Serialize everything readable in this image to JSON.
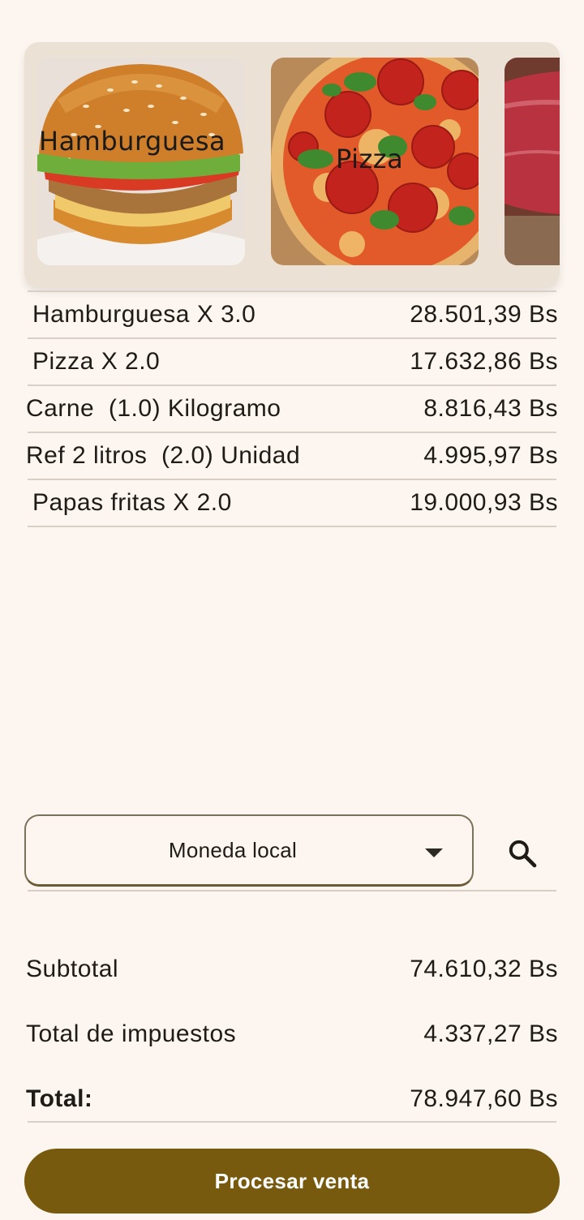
{
  "products": [
    {
      "label": "Hamburguesa",
      "icon": "burger-image"
    },
    {
      "label": "Pizza",
      "icon": "pizza-image"
    },
    {
      "label": "",
      "icon": "meat-image"
    }
  ],
  "items": [
    {
      "name": "Hamburguesa X 3.0",
      "price": "28.501,39 Bs"
    },
    {
      "name": "Pizza X 2.0",
      "price": "17.632,86 Bs"
    },
    {
      "name": "Carne  (1.0) Kilogramo",
      "price": "8.816,43 Bs"
    },
    {
      "name": "Ref 2 litros  (2.0) Unidad",
      "price": "4.995,97 Bs"
    },
    {
      "name": "Papas fritas X 2.0",
      "price": "19.000,93 Bs"
    }
  ],
  "currency": {
    "selected": "Moneda local",
    "search_icon": "search-icon"
  },
  "totals": {
    "subtotal_label": "Subtotal",
    "subtotal_value": "74.610,32 Bs",
    "tax_label": "Total de impuestos",
    "tax_value": "4.337,27 Bs",
    "total_label": "Total:",
    "total_value": "78.947,60 Bs"
  },
  "actions": {
    "process_label": "Procesar venta"
  },
  "colors": {
    "background": "#fdf6f0",
    "accent": "#785a0f",
    "carousel_bg": "#ebe1d4"
  }
}
